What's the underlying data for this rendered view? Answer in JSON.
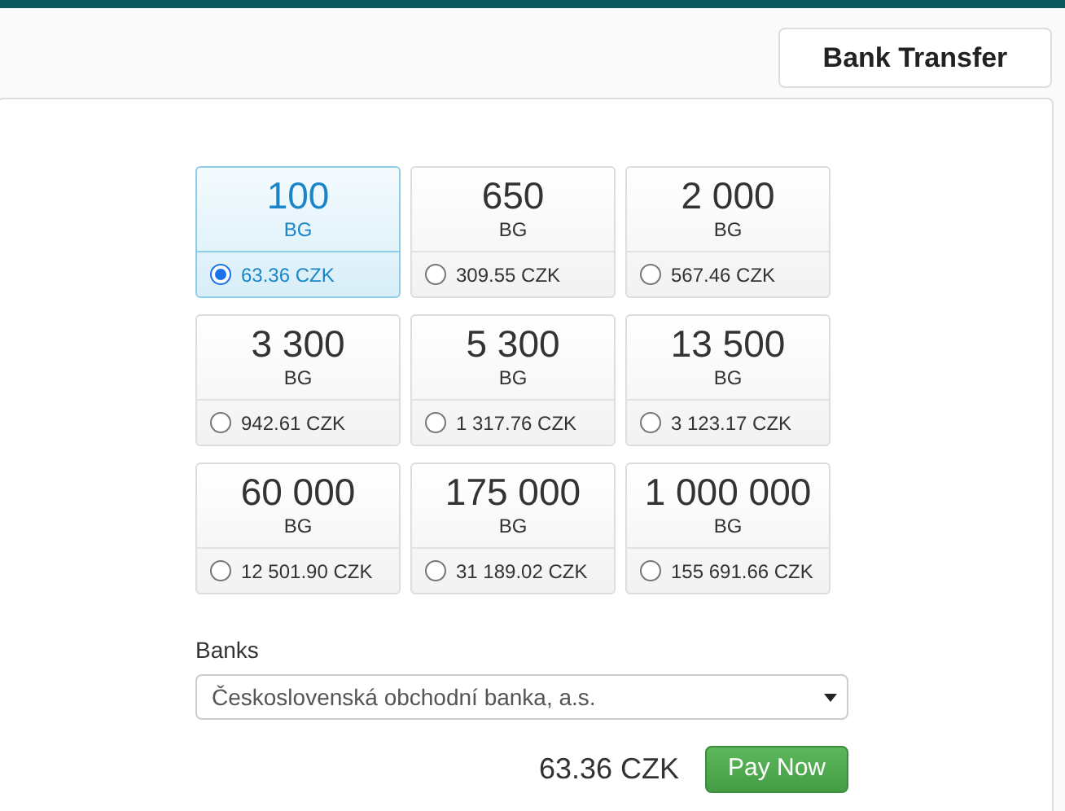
{
  "tabs": [
    {
      "label": "Bank Transfer",
      "selected": true
    }
  ],
  "packages": [
    {
      "amount": "100",
      "unit": "BG",
      "price": "63.36 CZK",
      "selected": true
    },
    {
      "amount": "650",
      "unit": "BG",
      "price": "309.55 CZK",
      "selected": false
    },
    {
      "amount": "2 000",
      "unit": "BG",
      "price": "567.46 CZK",
      "selected": false
    },
    {
      "amount": "3 300",
      "unit": "BG",
      "price": "942.61 CZK",
      "selected": false
    },
    {
      "amount": "5 300",
      "unit": "BG",
      "price": "1 317.76 CZK",
      "selected": false
    },
    {
      "amount": "13 500",
      "unit": "BG",
      "price": "3 123.17 CZK",
      "selected": false
    },
    {
      "amount": "60 000",
      "unit": "BG",
      "price": "12 501.90 CZK",
      "selected": false
    },
    {
      "amount": "175 000",
      "unit": "BG",
      "price": "31 189.02 CZK",
      "selected": false
    },
    {
      "amount": "1 000 000",
      "unit": "BG",
      "price": "155 691.66 CZK",
      "selected": false
    }
  ],
  "banks": {
    "label": "Banks",
    "value": "Československá obchodní banka, a.s."
  },
  "total": "63.36 CZK",
  "pay_button": "Pay Now"
}
